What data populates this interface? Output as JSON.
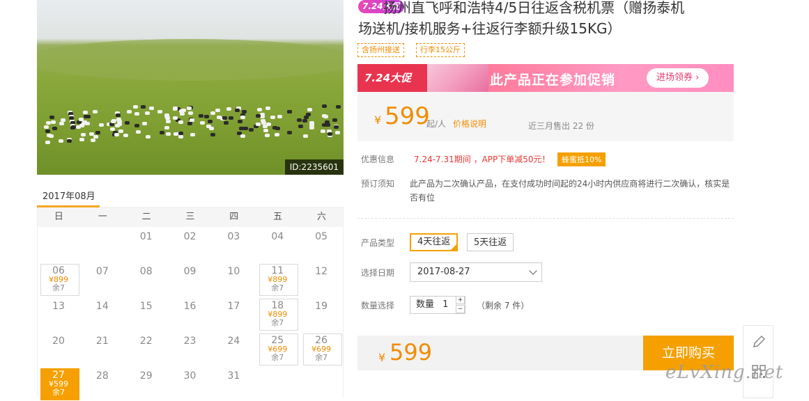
{
  "photo": {
    "id_label": "ID:2235601"
  },
  "calendar": {
    "month": "2017年08月",
    "weekdays": [
      "日",
      "一",
      "二",
      "三",
      "四",
      "五",
      "六"
    ],
    "days": [
      {
        "d": "01"
      },
      {
        "d": "02"
      },
      {
        "d": "03"
      },
      {
        "d": "04"
      },
      {
        "d": "05"
      },
      {
        "d": "06",
        "price": "¥899",
        "rem": "余7"
      },
      {
        "d": "07"
      },
      {
        "d": "08"
      },
      {
        "d": "09"
      },
      {
        "d": "10"
      },
      {
        "d": "11",
        "price": "¥899",
        "rem": "余7"
      },
      {
        "d": "12"
      },
      {
        "d": "13"
      },
      {
        "d": "14"
      },
      {
        "d": "15"
      },
      {
        "d": "16"
      },
      {
        "d": "17"
      },
      {
        "d": "18",
        "price": "¥899",
        "rem": "余7"
      },
      {
        "d": "19"
      },
      {
        "d": "20"
      },
      {
        "d": "21"
      },
      {
        "d": "22"
      },
      {
        "d": "23"
      },
      {
        "d": "24"
      },
      {
        "d": "25",
        "price": "¥699",
        "rem": "余7"
      },
      {
        "d": "26",
        "price": "¥699",
        "rem": "余7"
      },
      {
        "d": "27",
        "price": "¥599",
        "rem": "余7",
        "selected": true
      },
      {
        "d": "28"
      },
      {
        "d": "29"
      },
      {
        "d": "30"
      },
      {
        "d": "31"
      }
    ]
  },
  "product": {
    "promo_badge": "7.24大促",
    "title_line1": "扬州直飞呼和浩特4/5日往返含税机票（赠扬泰机",
    "title_line2": "场送机/接机服务+往返行李额升级15KG）",
    "tags": [
      "含扬州接送",
      "行李15公斤"
    ]
  },
  "banner": {
    "logo": "7.24大促",
    "text": "此产品正在参加促销",
    "button": "进场领券 ›"
  },
  "price": {
    "currency": "¥",
    "value": "599",
    "per": "起/人",
    "explain": "价格说明",
    "sold": "近三月售出 22 份"
  },
  "discount": {
    "label": "优惠信息",
    "text": "7.24-7.31期间 ，APP下单减50元！",
    "honey": "蜂蜜抵10%"
  },
  "notice": {
    "label": "预订须知",
    "text": "此产品为二次确认产品，在支付成功时间起的24小时内供应商将进行二次确认，核实是否有位"
  },
  "options": {
    "type_label": "产品类型",
    "types": [
      "4天往返",
      "5天往返"
    ],
    "date_label": "选择日期",
    "date_value": "2017-08-27",
    "qty_label": "数量选择",
    "qty_prefix": "数量",
    "qty_value": "1",
    "qty_up": "+",
    "qty_down": "−",
    "remaining": "（剩余 7 件）"
  },
  "bottom": {
    "currency": "¥",
    "value": "599",
    "buy": "立即购买"
  },
  "side": {
    "edit_icon": "pencil-icon",
    "qr_icon": "qrcode-icon"
  },
  "watermark": "eLvXing.net",
  "colors": {
    "accent": "#f5a000",
    "price": "#f08c00",
    "discount": "#e53935"
  }
}
